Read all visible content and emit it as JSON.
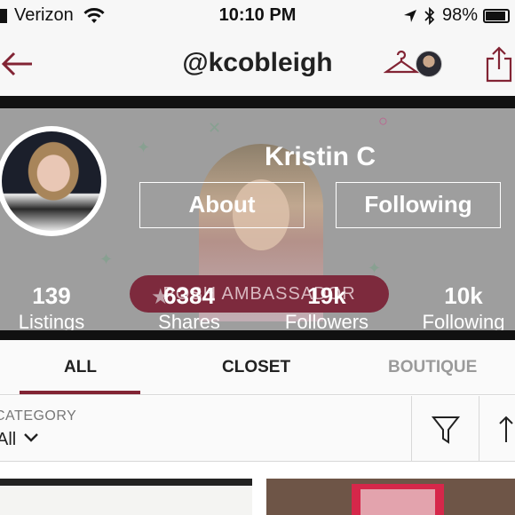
{
  "status_bar": {
    "carrier": "Verizon",
    "time": "10:10 PM",
    "battery": "98%"
  },
  "nav": {
    "title": "@kcobleigh"
  },
  "profile": {
    "name": "Kristin C",
    "about_label": "About",
    "following_label": "Following",
    "ambassador_badge": "POSH AMBASSADOR",
    "stats": [
      {
        "value": "139",
        "label": "Listings"
      },
      {
        "value": "6384",
        "label": "Shares"
      },
      {
        "value": "19k",
        "label": "Followers"
      },
      {
        "value": "10k",
        "label": "Following"
      }
    ]
  },
  "tabs": [
    {
      "label": "ALL",
      "active": true
    },
    {
      "label": "CLOSET",
      "active": false
    },
    {
      "label": "BOUTIQUE",
      "active": false
    }
  ],
  "filters": {
    "category_label": "CATEGORY",
    "category_value": "All"
  },
  "colors": {
    "accent": "#822434",
    "ambassador_bg": "#7d2a3d",
    "banner_overlay": "#9e9e9e"
  },
  "icons": [
    "signal-icon",
    "wifi-icon",
    "location-arrow-icon",
    "bluetooth-icon",
    "battery-icon",
    "back-arrow-icon",
    "hanger-icon",
    "share-icon",
    "star-icon",
    "chevron-down-icon",
    "filter-funnel-icon",
    "sort-icon"
  ]
}
